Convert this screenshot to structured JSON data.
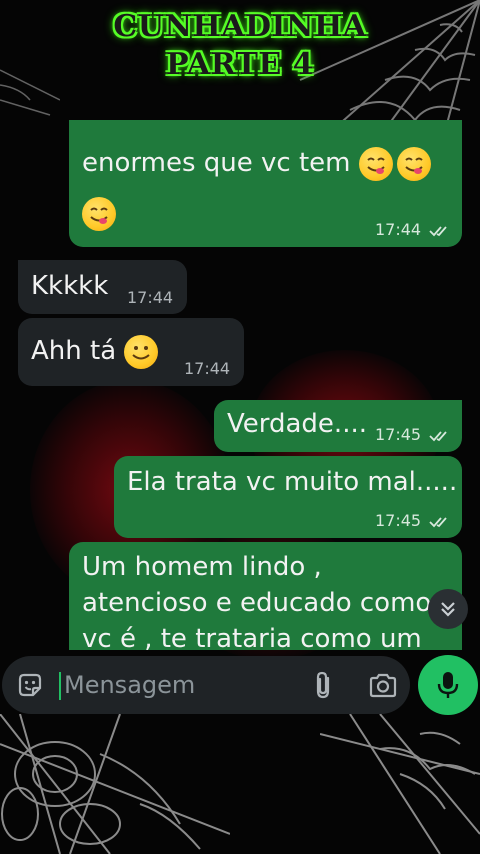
{
  "title": {
    "line1": "CUNHADINHA",
    "line2": "PARTE 4"
  },
  "messages": [
    {
      "id": "m1",
      "direction": "outgoing",
      "text": "enormes que vc tem",
      "time": "17:44",
      "status": "read"
    },
    {
      "id": "m2",
      "direction": "incoming",
      "text": "Kkkkk",
      "time": "17:44"
    },
    {
      "id": "m3",
      "direction": "incoming",
      "text": "Ahh tá",
      "time": "17:44"
    },
    {
      "id": "m4",
      "direction": "outgoing",
      "text": "Verdade....",
      "time": "17:45",
      "status": "read"
    },
    {
      "id": "m5",
      "direction": "outgoing",
      "text": "Ela trata vc muito mal.....",
      "time": "17:45",
      "status": "read"
    },
    {
      "id": "m6",
      "direction": "outgoing",
      "lines": [
        "Um homem lindo ,",
        "atencioso e educado como",
        "vc é  , te trataria como um"
      ]
    }
  ],
  "composer": {
    "placeholder": "Mensagem"
  },
  "icons": {
    "sticker": "sticker-icon",
    "attach": "paperclip-icon",
    "camera": "camera-icon",
    "mic": "microphone-icon",
    "scroll": "double-chevron-down-icon",
    "read": "double-check-icon"
  },
  "colors": {
    "outgoing_bubble": "#1f7a3c",
    "incoming_bubble": "#1f2326",
    "accent_green": "#21c063",
    "title_glow": "#5cff2a",
    "read_tick": "#d7e8dc"
  }
}
